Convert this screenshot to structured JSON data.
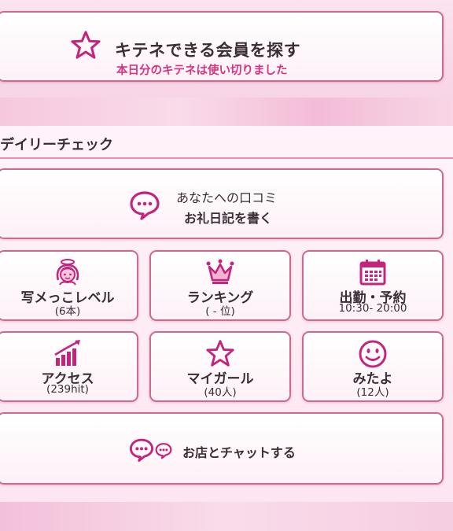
{
  "kitene": {
    "title": "キテネできる会員を探す",
    "subtitle": "本日分のキテネは使い切りました"
  },
  "daily": {
    "header": "デイリーチェック",
    "review": {
      "line1": "あなたへの口コミ",
      "line2": "お礼日記を書く"
    },
    "tiles": [
      {
        "label": "写メっこレベル",
        "sub": "(6本)",
        "icon": "angel-girl-icon"
      },
      {
        "label": "ランキング",
        "sub": "( - 位)",
        "icon": "crown-icon"
      },
      {
        "label": "出勤・予約",
        "sub": "10:30- 20:00",
        "icon": "calendar-icon"
      },
      {
        "label": "アクセス",
        "sub": "(239hit)",
        "icon": "bar-chart-icon"
      },
      {
        "label": "マイガール",
        "sub": "(40人)",
        "icon": "star-icon"
      },
      {
        "label": "みたよ",
        "sub": "(12人)",
        "icon": "smiley-icon"
      }
    ],
    "chat": {
      "label": "お店とチャットする"
    }
  },
  "colors": {
    "accent": "#c5247d",
    "border": "#c96b92",
    "subtitle": "#d6347d"
  }
}
